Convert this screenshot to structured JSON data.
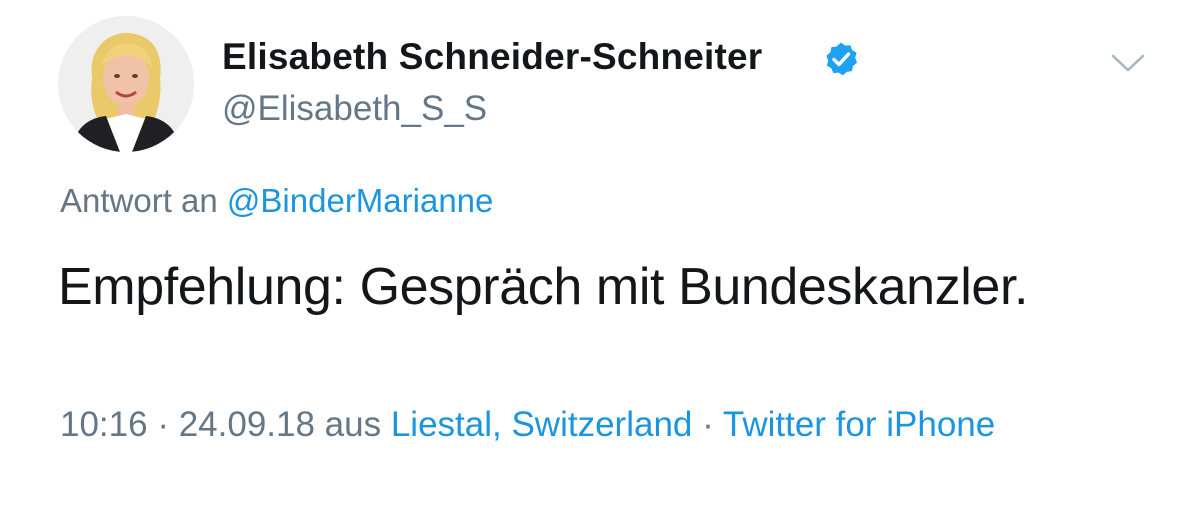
{
  "author": {
    "display_name": "Elisabeth Schneider-Schneiter",
    "handle": "@Elisabeth_S_S",
    "verified": true,
    "avatar_icon": "profile-photo"
  },
  "reply": {
    "prefix": "Antwort an",
    "to_handle": "@BinderMarianne"
  },
  "tweet": {
    "text": "Empfehlung: Gespräch mit Bundeskanzler."
  },
  "meta": {
    "time": "10:16",
    "separator1": " · ",
    "date": "24.09.18",
    "location_prefix": " aus ",
    "location": "Liestal, Switzerland",
    "separator2": " · ",
    "source": "Twitter for iPhone"
  },
  "colors": {
    "link": "#1b95e0",
    "secondary_text": "#657786",
    "primary_text": "#14171a",
    "verified_badge": "#1da1f2"
  },
  "icons": {
    "verified": "verified-badge-icon",
    "menu": "chevron-down-icon"
  }
}
